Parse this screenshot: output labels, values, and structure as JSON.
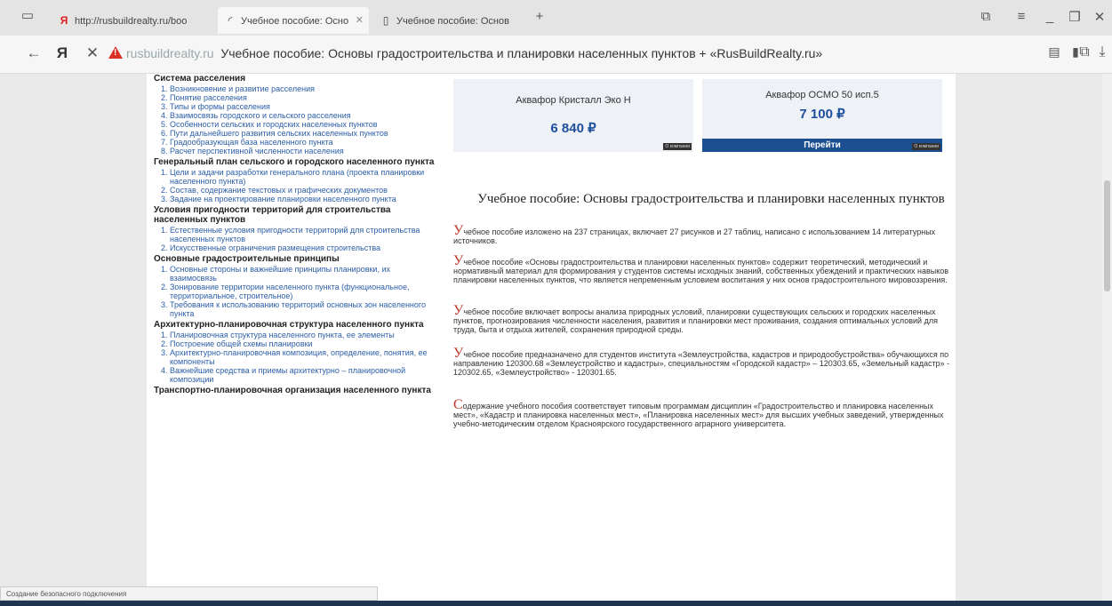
{
  "tabs": [
    {
      "label": "http://rusbuildrealty.ru/boo",
      "icon": "yandex-icon"
    },
    {
      "label": "Учебное пособие: Осно",
      "icon": "loading-icon"
    },
    {
      "label": "Учебное пособие: Основ",
      "icon": "document-icon"
    }
  ],
  "new_tab_label": "+",
  "address": {
    "domain": "rusbuildrealty.ru",
    "title": "Учебное пособие: Основы градостроительства и планировки населенных пунктов + «RusBuildRealty.ru»"
  },
  "sidebar": [
    {
      "heading": "Система расселения",
      "items": [
        "Возникновение и развитие расселения",
        "Понятие расселения",
        "Типы и формы расселения",
        "Взаимосвязь городского и сельского расселения",
        "Особенности сельских и городских населенных пунктов",
        "Пути дальнейшего развития сельских населенных пунктов",
        "Градообразующая база населенного пункта",
        "Расчет перспективной численности населения"
      ]
    },
    {
      "heading": "Генеральный план сельского и городского населенного пункта",
      "items": [
        "Цели и задачи разработки генерального плана (проекта планировки населенного пункта)",
        "Состав, содержание текстовых и графических документов",
        "Задание на проектирование планировки населенного пункта"
      ]
    },
    {
      "heading": "Условия пригодности территорий для строительства населенных пунктов",
      "items": [
        "Естественные условия пригодности территорий для строительства населенных пунктов",
        "Искусственные ограничения размещения строительства"
      ]
    },
    {
      "heading": "Основные градостроительные принципы",
      "items": [
        "Основные стороны и важнейшие принципы планировки, их взаимосвязь",
        "Зонирование территории населенного пункта (функциональное, территориальное, строительное)",
        "Требования к использованию территорий основных зон населенного пункта"
      ]
    },
    {
      "heading": "Архитектурно-планировочная структура населенного пункта",
      "items": [
        "Планировочная структура населенного пункта, ее элементы",
        "Построение общей схемы планировки",
        "Архитектурно-планировочная композиция, определение, понятия, ее компоненты",
        "Важнейшие средства и приемы архитектурно – планировочной композиции"
      ]
    },
    {
      "heading": "Транспортно-планировочная организация населенного пункта",
      "items": []
    }
  ],
  "products": [
    {
      "name": "Аквафор Кристалл Эко Н",
      "price": "6 840 ₽",
      "button": "",
      "badge": "О компании"
    },
    {
      "name": "Аквафор ОСМО 50 исп.5",
      "price": "7 100 ₽",
      "button": "Перейти",
      "badge": "О компании"
    }
  ],
  "article": {
    "title": "Учебное пособие: Основы градостроительства и планировки населенных пунктов",
    "paragraphs": [
      {
        "drop": "У",
        "text": "чебное пособие изложено на 237 страницах, включает 27 рисунков и 27 таблиц, написано с использованием 14 литературных источников."
      },
      {
        "drop": "У",
        "text": "чебное пособие «Основы градостроительства и планировки населенных пунктов» содержит теоретический, методический и нормативный материал для формирования у студентов системы исходных знаний, собственных убеждений и практических навыков планировки населенных пунктов, что является непременным условием воспитания у них основ градостроительного мировоззрения."
      },
      {
        "drop": "У",
        "text": "чебное пособие включает вопросы анализа природных условий, планировки существующих сельских и городских населенных пунктов, прогнозирования численности населения, развития и планировки мест проживания, создания оптимальных условий для труда, быта и отдыха жителей, сохранения природной среды."
      },
      {
        "drop": "У",
        "text": "чебное пособие предназначено для студентов института «Землеустройства, кадастров и природообустройства» обучающихся по направлению 120300.68 «Землеустройство и кадастры», специальностям «Городской кадастр» – 120303.65, «Земельный кадастр» - 120302.65, «Землеустройство» - 120301.65."
      },
      {
        "drop": "С",
        "text": "одержание учебного пособия соответствует типовым программам дисциплин «Градостроительство и планировка населенных мест», «Кадастр и планировка населенных мест», «Планировка населенных мест» для высших учебных заведений, утвержденных учебно-методическим отделом Красноярского государственного аграрного университета."
      }
    ]
  },
  "status_text": "Создание безопасного подключения"
}
